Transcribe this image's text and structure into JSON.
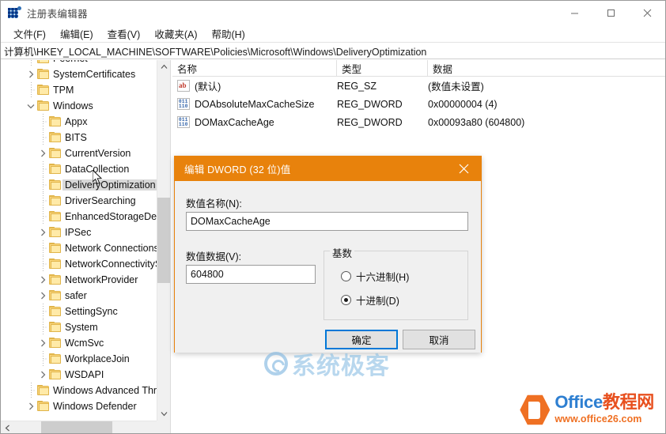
{
  "window": {
    "title": "注册表编辑器",
    "icon": "registry-icon",
    "controls": {
      "minimize": "minimize-icon",
      "maximize": "maximize-icon",
      "close": "close-icon"
    }
  },
  "menu": {
    "items": [
      {
        "label": "文件(F)"
      },
      {
        "label": "编辑(E)"
      },
      {
        "label": "查看(V)"
      },
      {
        "label": "收藏夹(A)"
      },
      {
        "label": "帮助(H)"
      }
    ]
  },
  "address": {
    "path": "计算机\\HKEY_LOCAL_MACHINE\\SOFTWARE\\Policies\\Microsoft\\Windows\\DeliveryOptimization"
  },
  "tree": {
    "items": [
      {
        "label": "Peernet",
        "indent": 2,
        "expander": "none",
        "selected": false
      },
      {
        "label": "SystemCertificates",
        "indent": 2,
        "expander": "collapsed",
        "selected": false
      },
      {
        "label": "TPM",
        "indent": 2,
        "expander": "none",
        "selected": false
      },
      {
        "label": "Windows",
        "indent": 2,
        "expander": "expanded",
        "selected": false
      },
      {
        "label": "Appx",
        "indent": 3,
        "expander": "none",
        "selected": false
      },
      {
        "label": "BITS",
        "indent": 3,
        "expander": "none",
        "selected": false
      },
      {
        "label": "CurrentVersion",
        "indent": 3,
        "expander": "collapsed",
        "selected": false
      },
      {
        "label": "DataCollection",
        "indent": 3,
        "expander": "none",
        "selected": false
      },
      {
        "label": "DeliveryOptimization",
        "indent": 3,
        "expander": "none",
        "selected": true
      },
      {
        "label": "DriverSearching",
        "indent": 3,
        "expander": "none",
        "selected": false
      },
      {
        "label": "EnhancedStorageDevices",
        "indent": 3,
        "expander": "none",
        "selected": false
      },
      {
        "label": "IPSec",
        "indent": 3,
        "expander": "collapsed",
        "selected": false
      },
      {
        "label": "Network Connections",
        "indent": 3,
        "expander": "none",
        "selected": false
      },
      {
        "label": "NetworkConnectivityStatusIndicator",
        "indent": 3,
        "expander": "none",
        "selected": false
      },
      {
        "label": "NetworkProvider",
        "indent": 3,
        "expander": "collapsed",
        "selected": false
      },
      {
        "label": "safer",
        "indent": 3,
        "expander": "collapsed",
        "selected": false
      },
      {
        "label": "SettingSync",
        "indent": 3,
        "expander": "none",
        "selected": false
      },
      {
        "label": "System",
        "indent": 3,
        "expander": "none",
        "selected": false
      },
      {
        "label": "WcmSvc",
        "indent": 3,
        "expander": "collapsed",
        "selected": false
      },
      {
        "label": "WorkplaceJoin",
        "indent": 3,
        "expander": "none",
        "selected": false
      },
      {
        "label": "WSDAPI",
        "indent": 3,
        "expander": "collapsed",
        "selected": false
      },
      {
        "label": "Windows Advanced Threat Protection",
        "indent": 2,
        "expander": "none",
        "selected": false
      },
      {
        "label": "Windows Defender",
        "indent": 2,
        "expander": "collapsed",
        "selected": false
      }
    ]
  },
  "list": {
    "columns": [
      {
        "label": "名称"
      },
      {
        "label": "类型"
      },
      {
        "label": "数据"
      }
    ],
    "rows": [
      {
        "icon": "string-value-icon",
        "name": "(默认)",
        "type": "REG_SZ",
        "data": "(数值未设置)"
      },
      {
        "icon": "dword-value-icon",
        "name": "DOAbsoluteMaxCacheSize",
        "type": "REG_DWORD",
        "data": "0x00000004 (4)"
      },
      {
        "icon": "dword-value-icon",
        "name": "DOMaxCacheAge",
        "type": "REG_DWORD",
        "data": "0x00093a80 (604800)"
      }
    ]
  },
  "dialog": {
    "title": "编辑 DWORD (32 位)值",
    "close_icon": "close-icon",
    "name_label": "数值名称(N):",
    "name_value": "DOMaxCacheAge",
    "data_label": "数值数据(V):",
    "data_value": "604800",
    "base_group_label": "基数",
    "radios": [
      {
        "label": "十六进制(H)",
        "checked": false
      },
      {
        "label": "十进制(D)",
        "checked": true
      }
    ],
    "ok_label": "确定",
    "cancel_label": "取消"
  },
  "watermarks": {
    "center_text": "系统极客",
    "logo_text_en": "Office",
    "logo_text_cn": "教程网",
    "logo_url": "www.office26.com"
  },
  "colors": {
    "dialog_accent": "#e8820c",
    "focus_border": "#0078d7",
    "folder": "#fbd77f",
    "watermark_blue": "#8dc0e4",
    "logo_orange": "#ef7023"
  }
}
